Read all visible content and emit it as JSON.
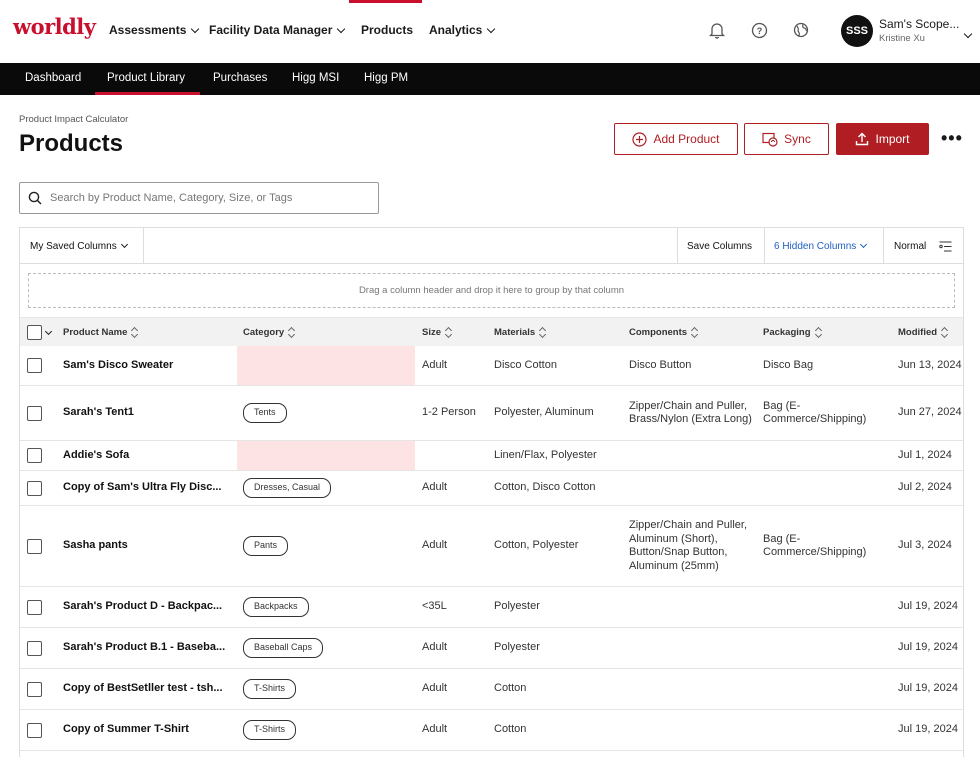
{
  "brand": {
    "logo": "worldly",
    "accent": "#c8102e"
  },
  "topnav": {
    "items": [
      "Assessments",
      "Facility Data Manager",
      "Products",
      "Analytics"
    ],
    "user": {
      "initials": "SSS",
      "name": "Sam's Scope...",
      "sub": "Kristine Xu"
    },
    "icons": [
      "bell-icon",
      "help-icon",
      "globe-icon"
    ]
  },
  "subnav": {
    "items": [
      "Dashboard",
      "Product Library",
      "Purchases",
      "Higg MSI",
      "Higg PM"
    ],
    "active": "Product Library"
  },
  "header": {
    "breadcrumb": "Product Impact Calculator",
    "title": "Products",
    "add_label": "Add Product",
    "sync_label": "Sync",
    "import_label": "Import",
    "more_label": "•••"
  },
  "search": {
    "placeholder": "Search by Product Name, Category, Size, or Tags",
    "value": ""
  },
  "toolbar": {
    "saved_columns": "My Saved Columns",
    "save_columns": "Save Columns",
    "hidden_columns": "6 Hidden Columns",
    "density": "Normal"
  },
  "dropzone": "Drag a column header and drop it here to group by that column",
  "columns": [
    "Product Name",
    "Category",
    "Size",
    "Materials",
    "Components",
    "Packaging",
    "Modified"
  ],
  "rows": [
    {
      "name": "Sam's Disco Sweater",
      "category": "",
      "size": "Adult",
      "materials": "Disco Cotton",
      "components": "Disco Button",
      "packaging": "Disco Bag",
      "modified": "Jun 13, 2024"
    },
    {
      "name": "Sarah's Tent1",
      "category": "Tents",
      "size": "1-2 Person",
      "materials": "Polyester, Aluminum",
      "components": "Zipper/Chain and Puller, Brass/Nylon (Extra Long)",
      "packaging": "Bag (E-Commerce/Shipping)",
      "modified": "Jun 27, 2024"
    },
    {
      "name": "Addie's Sofa",
      "category": "",
      "size": "",
      "materials": "Linen/Flax, Polyester",
      "components": "",
      "packaging": "",
      "modified": "Jul 1, 2024"
    },
    {
      "name": "Copy of Sam's Ultra Fly Disc...",
      "category": "Dresses, Casual",
      "size": "Adult",
      "materials": "Cotton, Disco Cotton",
      "components": "",
      "packaging": "",
      "modified": "Jul 2, 2024"
    },
    {
      "name": "Sasha pants",
      "category": "Pants",
      "size": "Adult",
      "materials": "Cotton, Polyester",
      "components": "Zipper/Chain and Puller, Aluminum (Short), Button/Snap Button, Aluminum (25mm)",
      "packaging": "Bag (E-Commerce/Shipping)",
      "modified": "Jul 3, 2024"
    },
    {
      "name": "Sarah's Product D - Backpac...",
      "category": "Backpacks",
      "size": "<35L",
      "materials": "Polyester",
      "components": "",
      "packaging": "",
      "modified": "Jul 19, 2024"
    },
    {
      "name": "Sarah's Product B.1 - Baseba...",
      "category": "Baseball Caps",
      "size": "Adult",
      "materials": "Polyester",
      "components": "",
      "packaging": "",
      "modified": "Jul 19, 2024"
    },
    {
      "name": "Copy of BestSetller test - tsh...",
      "category": "T-Shirts",
      "size": "Adult",
      "materials": "Cotton",
      "components": "",
      "packaging": "",
      "modified": "Jul 19, 2024"
    },
    {
      "name": "Copy of Summer T-Shirt",
      "category": "T-Shirts",
      "size": "Adult",
      "materials": "Cotton",
      "components": "",
      "packaging": "",
      "modified": "Jul 19, 2024"
    }
  ]
}
